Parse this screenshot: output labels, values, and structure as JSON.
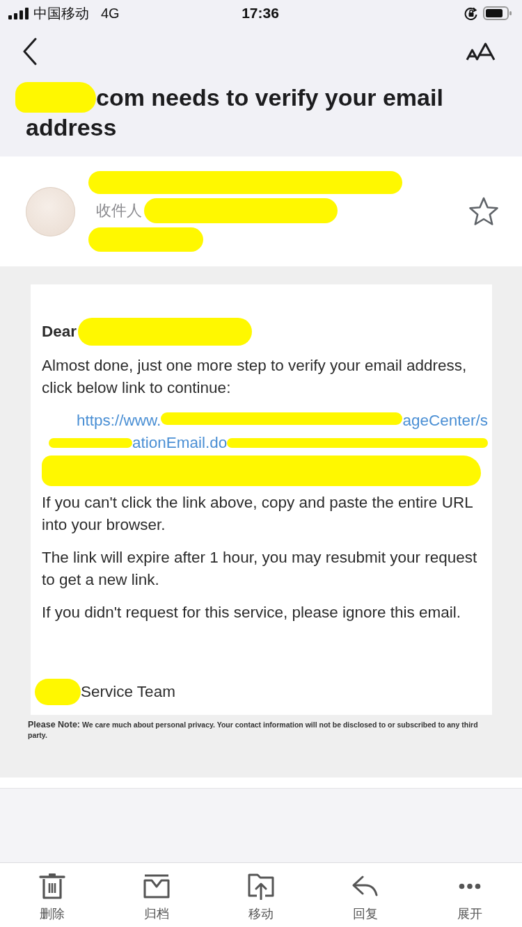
{
  "status_bar": {
    "carrier": "中国移动",
    "network": "4G",
    "time": "17:36"
  },
  "subject": {
    "redacted_lead": true,
    "text": "com needs to verify your email address"
  },
  "message_header": {
    "lines": [
      {
        "kind": "redaction"
      },
      {
        "kind": "recipient",
        "label": "收件人",
        "redacted": true
      },
      {
        "kind": "redaction"
      }
    ],
    "starred": false
  },
  "body": [
    {
      "kind": "greeting",
      "text": "Dear",
      "redacted": true
    },
    {
      "kind": "paragraph",
      "text": "Almost done, just one more step to verify your email address, click below link to continue:"
    },
    {
      "kind": "link",
      "lines": [
        [
          {
            "kind": "text",
            "text": "https://www."
          },
          {
            "kind": "redaction"
          },
          {
            "kind": "text",
            "text": "ageCenter/s"
          }
        ],
        [
          {
            "kind": "redaction"
          },
          {
            "kind": "text",
            "text": "ationEmail.do"
          },
          {
            "kind": "redaction"
          }
        ],
        [
          {
            "kind": "redaction"
          }
        ]
      ]
    },
    {
      "kind": "paragraph",
      "text": "If you can't click the link above, copy and paste the entire URL into your browser."
    },
    {
      "kind": "paragraph",
      "text": "The link will expire after 1 hour, you may resubmit your request to get a new link."
    },
    {
      "kind": "paragraph",
      "text": "If you didn't request for this service, please ignore this email."
    },
    {
      "kind": "signature",
      "redacted_lead": true,
      "text": "Service Team"
    }
  ],
  "note": {
    "label": "Please Note:",
    "text": "We care much about personal privacy. Your contact information will not be disclosed to or subscribed to any third party."
  },
  "toolbar": [
    {
      "kind": "delete",
      "label": "删除"
    },
    {
      "kind": "archive",
      "label": "归档"
    },
    {
      "kind": "move",
      "label": "移动"
    },
    {
      "kind": "reply",
      "label": "回复"
    },
    {
      "kind": "more",
      "label": "展开"
    }
  ]
}
